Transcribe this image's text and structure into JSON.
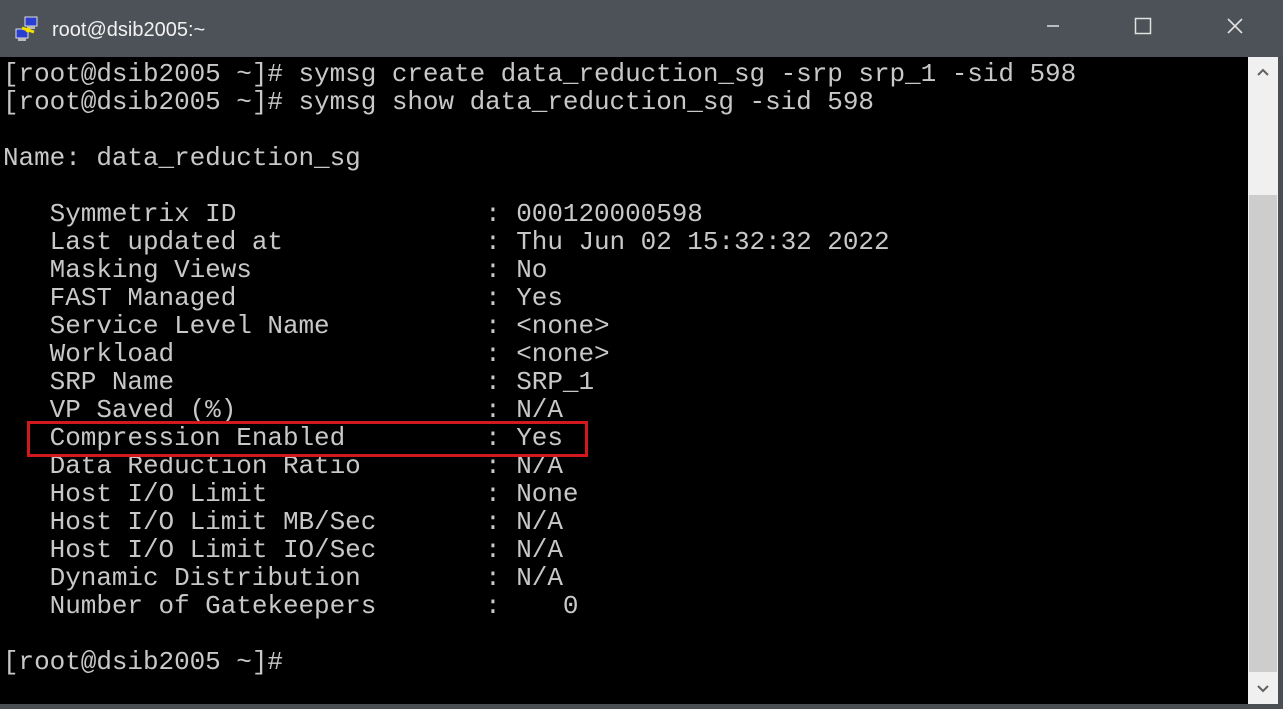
{
  "window": {
    "title": "root@dsib2005:~",
    "icon": "putty-network-icon",
    "controls": {
      "minimize": "minimize-icon",
      "maximize": "maximize-icon",
      "close": "close-icon"
    }
  },
  "terminal": {
    "lines": [
      "[root@dsib2005 ~]# symsg create data_reduction_sg -srp srp_1 -sid 598",
      "[root@dsib2005 ~]# symsg show data_reduction_sg -sid 598",
      "",
      "Name: data_reduction_sg",
      "",
      "   Symmetrix ID                : 000120000598",
      "   Last updated at             : Thu Jun 02 15:32:32 2022",
      "   Masking Views               : No",
      "   FAST Managed                : Yes",
      "   Service Level Name          : <none>",
      "   Workload                    : <none>",
      "   SRP Name                    : SRP_1",
      "   VP Saved (%)                : N/A",
      "   Compression Enabled         : Yes",
      "   Data Reduction Ratio        : N/A",
      "   Host I/O Limit              : None",
      "   Host I/O Limit MB/Sec       : N/A",
      "   Host I/O Limit IO/Sec       : N/A",
      "   Dynamic Distribution        : N/A",
      "   Number of Gatekeepers       :    0",
      "",
      "[root@dsib2005 ~]#"
    ],
    "highlighted_line": "Compression Enabled : Yes",
    "highlight_color": "#d2181f"
  },
  "scrollbar": {
    "up": "chevron-up-icon",
    "down": "chevron-down-icon"
  }
}
